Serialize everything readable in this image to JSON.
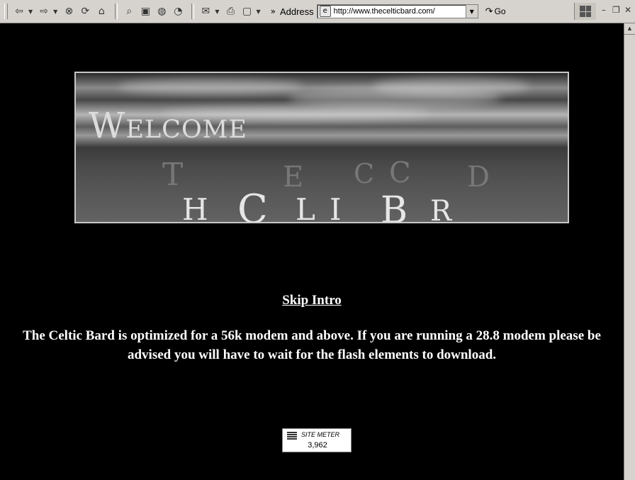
{
  "toolbar": {
    "back_icon": "back-arrow-icon",
    "forward_icon": "forward-arrow-icon",
    "address_label": "Address",
    "url": "http://www.thecelticbard.com/",
    "go_label": "Go"
  },
  "banner": {
    "welcome": "Welcome",
    "letters": [
      "T",
      "H",
      "C",
      "E",
      "C",
      "L",
      "I",
      "C",
      "B",
      "R",
      "D"
    ]
  },
  "page": {
    "skip_intro": "Skip Intro",
    "notice": "The Celtic Bard is optimized for a 56k modem and above.  If you are running a 28.8 modem please be advised you will have to wait for the flash elements to download."
  },
  "site_meter": {
    "title": "SITE METER",
    "count": "3,962"
  }
}
